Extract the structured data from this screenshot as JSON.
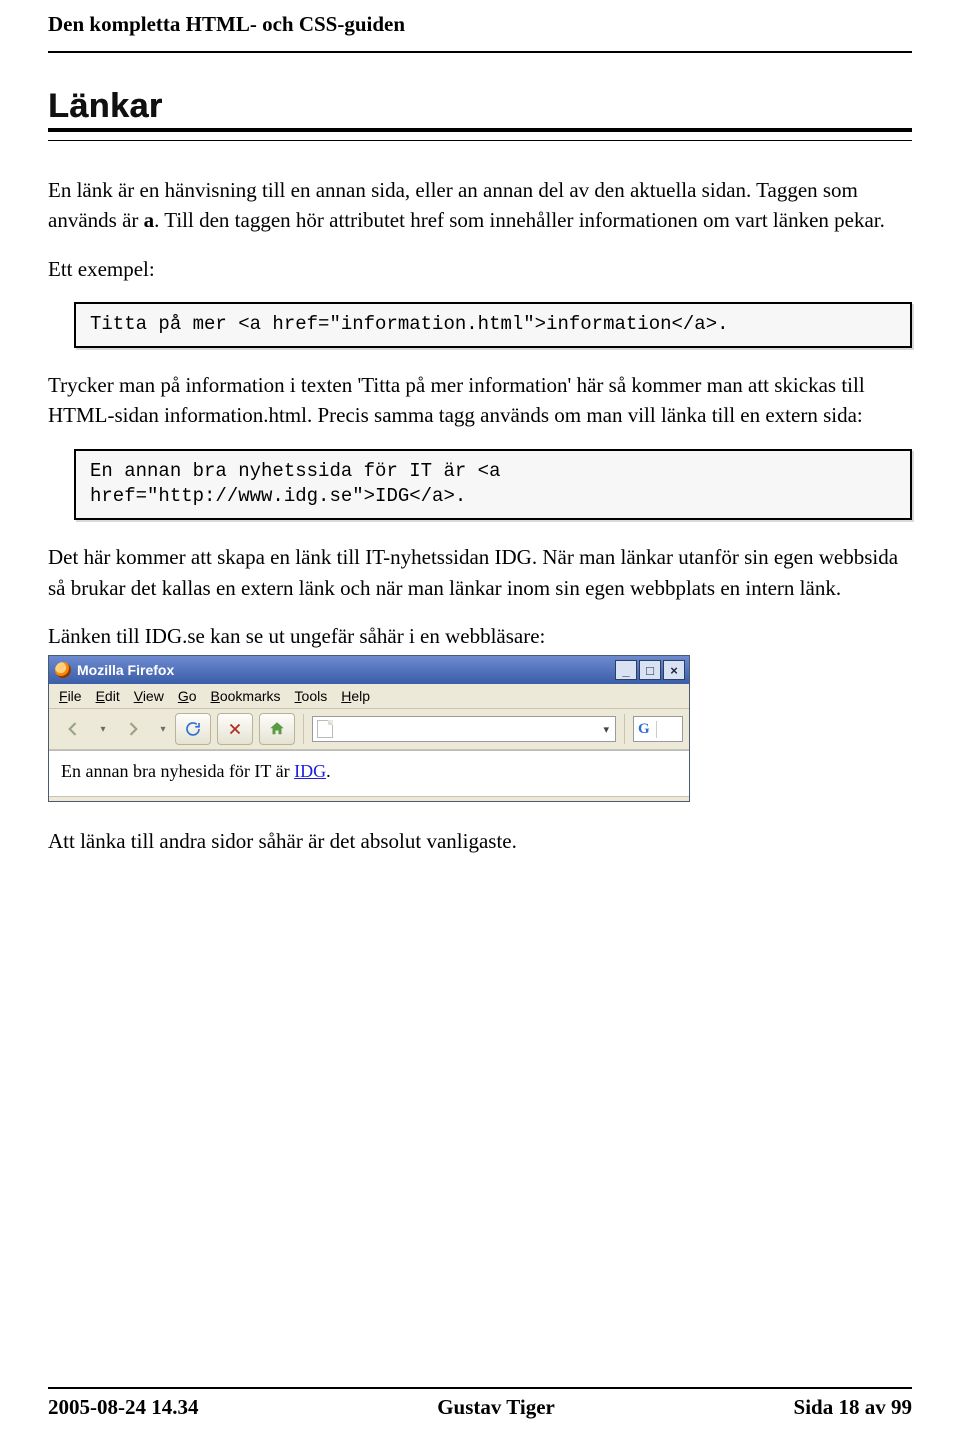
{
  "header": {
    "title": "Den kompletta HTML- och CSS-guiden"
  },
  "section": {
    "heading": "Länkar"
  },
  "paragraphs": {
    "p1a": "En länk är en hänvisning till en annan sida, eller an annan del av den aktuella sidan. Taggen som används är ",
    "p1b": "a",
    "p1c": ". Till den taggen hör attributet href som innehåller informationen om vart länken pekar.",
    "p2": "Ett exempel:",
    "p3": "Trycker man på information i texten 'Titta på mer information' här så kommer man att skickas till HTML-sidan information.html. Precis samma tagg används om man vill länka till en extern sida:",
    "p4": "Det här kommer att skapa en länk till IT-nyhetssidan IDG. När man länkar utanför sin egen webbsida så brukar det kallas en extern länk och när man länkar inom sin egen webbplats en intern länk.",
    "p5": "Länken till IDG.se kan se ut ungefär såhär i en webbläsare:",
    "p6": "Att länka till andra sidor såhär är det absolut vanligaste."
  },
  "code": {
    "c1": "Titta på mer <a href=\"information.html\">information</a>.",
    "c2": "En annan bra nyhetssida för IT är <a\nhref=\"http://www.idg.se\">IDG</a>."
  },
  "browser": {
    "title": "Mozilla Firefox",
    "menu": {
      "file": "File",
      "edit": "Edit",
      "view": "View",
      "go": "Go",
      "bookmarks": "Bookmarks",
      "tools": "Tools",
      "help": "Help"
    },
    "content_text": "En annan bra nyhesida för IT är ",
    "content_link": "IDG",
    "content_tail": "."
  },
  "footer": {
    "left": "2005-08-24 14.34",
    "center": "Gustav Tiger",
    "right": "Sida 18 av 99"
  }
}
